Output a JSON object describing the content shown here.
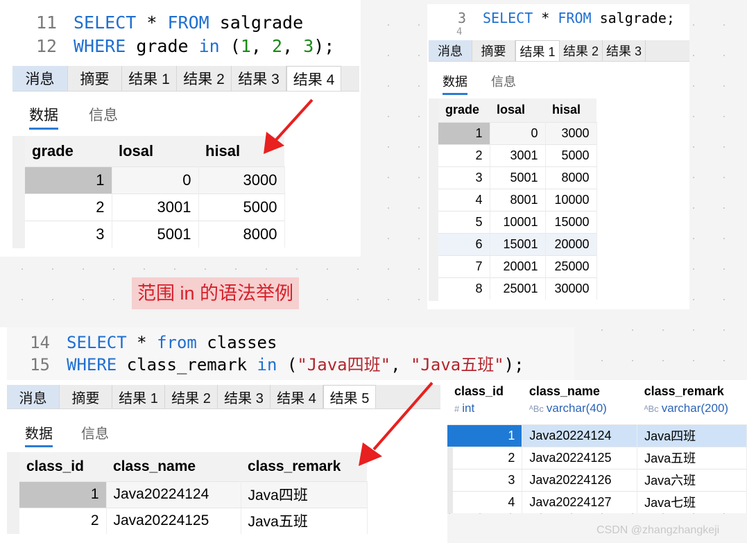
{
  "panel_a": {
    "code": [
      {
        "ln": "11",
        "parts": [
          [
            "kw",
            "SELECT"
          ],
          [
            "t",
            " * "
          ],
          [
            "kw",
            "FROM"
          ],
          [
            "t",
            " salgrade"
          ]
        ]
      },
      {
        "ln": "12",
        "parts": [
          [
            "kw",
            "WHERE"
          ],
          [
            "t",
            " grade "
          ],
          [
            "kw",
            "in"
          ],
          [
            "t",
            " ("
          ],
          [
            "num",
            "1"
          ],
          [
            "t",
            ", "
          ],
          [
            "num",
            "2"
          ],
          [
            "t",
            ", "
          ],
          [
            "num",
            "3"
          ],
          [
            "t",
            ");"
          ]
        ]
      }
    ],
    "tabs": [
      "消息",
      "摘要",
      "结果 1",
      "结果 2",
      "结果 3",
      "结果 4"
    ],
    "active_tab": "结果 4",
    "subtabs": [
      "数据",
      "信息"
    ],
    "columns": [
      "grade",
      "losal",
      "hisal"
    ],
    "rows": [
      [
        "1",
        "0",
        "3000"
      ],
      [
        "2",
        "3001",
        "5000"
      ],
      [
        "3",
        "5001",
        "8000"
      ]
    ]
  },
  "panel_b": {
    "code": [
      {
        "ln": "3",
        "parts": [
          [
            "kw",
            "SELECT"
          ],
          [
            "t",
            " * "
          ],
          [
            "kw",
            "FROM"
          ],
          [
            "t",
            " salgrade;"
          ]
        ]
      }
    ],
    "next_line_number": "4",
    "tabs": [
      "消息",
      "摘要",
      "结果 1",
      "结果 2",
      "结果 3"
    ],
    "active_tab": "结果 1",
    "subtabs": [
      "数据",
      "信息"
    ],
    "columns": [
      "grade",
      "losal",
      "hisal"
    ],
    "rows": [
      [
        "1",
        "0",
        "3000"
      ],
      [
        "2",
        "3001",
        "5000"
      ],
      [
        "3",
        "5001",
        "8000"
      ],
      [
        "4",
        "8001",
        "10000"
      ],
      [
        "5",
        "10001",
        "15000"
      ],
      [
        "6",
        "15001",
        "20000"
      ],
      [
        "7",
        "20001",
        "25000"
      ],
      [
        "8",
        "25001",
        "30000"
      ]
    ]
  },
  "caption": "范围 in 的语法举例",
  "panel_c": {
    "code": [
      {
        "ln": "14",
        "parts": [
          [
            "kw",
            "SELECT"
          ],
          [
            "t",
            " * "
          ],
          [
            "kw",
            "from"
          ],
          [
            "t",
            " classes"
          ]
        ]
      },
      {
        "ln": "15",
        "parts": [
          [
            "kw",
            "WHERE"
          ],
          [
            "t",
            " class_remark "
          ],
          [
            "kw",
            "in"
          ],
          [
            "t",
            " ("
          ],
          [
            "str",
            "\"Java四班\""
          ],
          [
            "t",
            ", "
          ],
          [
            "str",
            "\"Java五班\""
          ],
          [
            "t",
            ");"
          ]
        ]
      }
    ],
    "tabs": [
      "消息",
      "摘要",
      "结果 1",
      "结果 2",
      "结果 3",
      "结果 4",
      "结果 5"
    ],
    "active_tab": "结果 5",
    "subtabs": [
      "数据",
      "信息"
    ],
    "columns": [
      "class_id",
      "class_name",
      "class_remark"
    ],
    "rows": [
      [
        "1",
        "Java20224124",
        "Java四班"
      ],
      [
        "2",
        "Java20224125",
        "Java五班"
      ]
    ]
  },
  "panel_d": {
    "columns": [
      {
        "name": "class_id",
        "type": "int",
        "type_icon": "hash-icon",
        "type_glyph": "#"
      },
      {
        "name": "class_name",
        "type": "varchar(40)",
        "type_icon": "abc-type-icon",
        "type_glyph": "ᴬBc"
      },
      {
        "name": "class_remark",
        "type": "varchar(200)",
        "type_icon": "abc-type-icon",
        "type_glyph": "ᴬBc"
      }
    ],
    "rows": [
      [
        "1",
        "Java20224124",
        "Java四班"
      ],
      [
        "2",
        "Java20224125",
        "Java五班"
      ],
      [
        "3",
        "Java20224126",
        "Java六班"
      ],
      [
        "4",
        "Java20224127",
        "Java七班"
      ]
    ]
  },
  "watermark": "CSDN @zhangzhangkeji",
  "colors": {
    "keyword": "#1f6fd1",
    "string": "#b3262e",
    "number": "#1a8a1a",
    "arrow": "#e8201f",
    "selection": "#1f7ad6",
    "active_subtab": "#2b7bd6"
  }
}
